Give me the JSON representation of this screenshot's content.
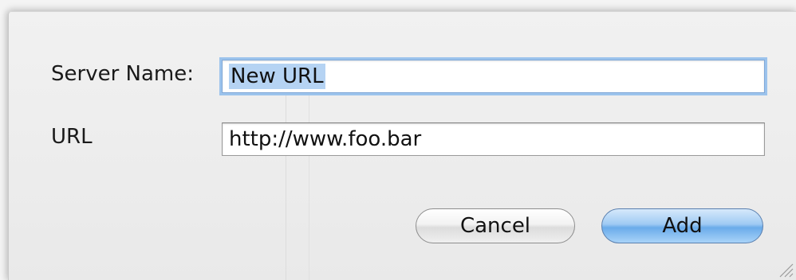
{
  "dialog": {
    "server_name_label": "Server Name:",
    "server_name_value": "New URL",
    "url_label": "URL",
    "url_value": "http://www.foo.bar",
    "cancel_label": "Cancel",
    "add_label": "Add"
  },
  "colors": {
    "default_button": "#6aabea",
    "focus_ring": "#9cc3ec",
    "selection": "#b5d3f3"
  }
}
